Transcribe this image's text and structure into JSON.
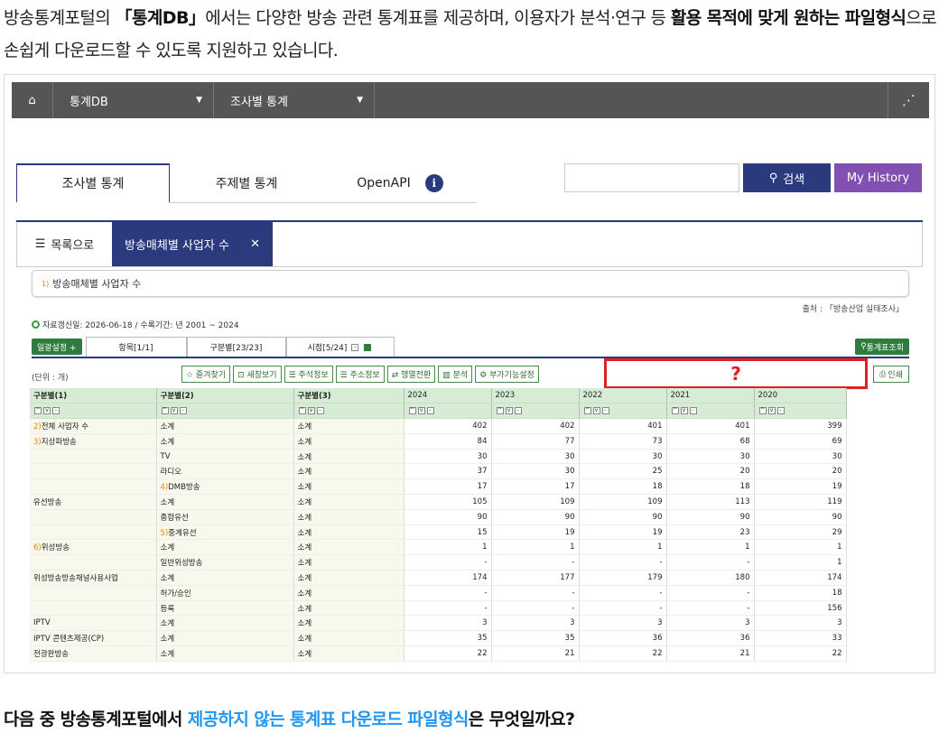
{
  "intro": {
    "p1": "방송통계포털의 ",
    "b1": "「통계DB」",
    "p2": "에서는 다양한 방송 관련 통계표를 제공하며, 이용자가 분석·연구 등 ",
    "b2": "활용 목적에 맞게 원하는 파일형식",
    "p3": "으로 손쉽게 다운로드할 수 있도록 지원하고 있습니다."
  },
  "topnav": {
    "home_icon": "home-icon",
    "menu1": "통계DB",
    "menu2": "조사별 통계",
    "share_icon": "share-icon"
  },
  "tabs": {
    "tab1": "조사별 통계",
    "tab2": "주제별 통계",
    "tab3": "OpenAPI",
    "info": "i"
  },
  "search": {
    "button": "검색",
    "history": "My History"
  },
  "subtabs": {
    "list": "목록으로",
    "active": "방송매체별 사업자 수",
    "close": "✕"
  },
  "title": {
    "num": "1)",
    "text": "방송매체별 사업자 수"
  },
  "source": "출처 :  「방송산업 실태조사」",
  "updated": "자료갱신일: 2026-06-18 / 수록기간: 년 2001 ~ 2024",
  "controls": {
    "bulk": "일괄설정 +",
    "items": "항목[1/1]",
    "cats": "구분별[23/23]",
    "time": "시점[5/24]",
    "view": "통계표조회"
  },
  "unit": "(단위 : 개)",
  "toolbar": [
    "☆ 즐겨찾기",
    "⊡ 새창보기",
    "☰ 주석정보",
    "☰ 주소정보",
    "⇄ 행열전환",
    "▥ 분석",
    "⚙ 부가기능설정"
  ],
  "question_mark": "?",
  "print": "인쇄",
  "table": {
    "headers": [
      "구분별(1)",
      "구분별(2)",
      "구분별(3)",
      "2024",
      "2023",
      "2022",
      "2021",
      "2020"
    ],
    "rows": [
      {
        "c1": "전체 사업자 수",
        "s1": "2)",
        "c2": "소계",
        "s2": "",
        "c3": "소계",
        "v": [
          "402",
          "402",
          "401",
          "401",
          "399"
        ]
      },
      {
        "c1": "지상파방송",
        "s1": "3)",
        "c2": "소계",
        "s2": "",
        "c3": "소계",
        "v": [
          "84",
          "77",
          "73",
          "68",
          "69"
        ]
      },
      {
        "c1": "",
        "s1": "",
        "c2": "TV",
        "s2": "",
        "c3": "소계",
        "v": [
          "30",
          "30",
          "30",
          "30",
          "30"
        ]
      },
      {
        "c1": "",
        "s1": "",
        "c2": "라디오",
        "s2": "",
        "c3": "소계",
        "v": [
          "37",
          "30",
          "25",
          "20",
          "20"
        ]
      },
      {
        "c1": "",
        "s1": "",
        "c2": "DMB방송",
        "s2": "4)",
        "c3": "소계",
        "v": [
          "17",
          "17",
          "18",
          "18",
          "19"
        ]
      },
      {
        "c1": "유선방송",
        "s1": "",
        "c2": "소계",
        "s2": "",
        "c3": "소계",
        "v": [
          "105",
          "109",
          "109",
          "113",
          "119"
        ]
      },
      {
        "c1": "",
        "s1": "",
        "c2": "종합유선",
        "s2": "",
        "c3": "소계",
        "v": [
          "90",
          "90",
          "90",
          "90",
          "90"
        ]
      },
      {
        "c1": "",
        "s1": "",
        "c2": "중계유선",
        "s2": "5)",
        "c3": "소계",
        "v": [
          "15",
          "19",
          "19",
          "23",
          "29"
        ]
      },
      {
        "c1": "위성방송",
        "s1": "6)",
        "c2": "소계",
        "s2": "",
        "c3": "소계",
        "v": [
          "1",
          "1",
          "1",
          "1",
          "1"
        ]
      },
      {
        "c1": "",
        "s1": "",
        "c2": "일반위성방송",
        "s2": "",
        "c3": "소계",
        "v": [
          "-",
          "-",
          "-",
          "-",
          "1"
        ]
      },
      {
        "c1": "위성방송방송채널사용사업",
        "s1": "",
        "c2": "소계",
        "s2": "",
        "c3": "소계",
        "v": [
          "174",
          "177",
          "179",
          "180",
          "174"
        ]
      },
      {
        "c1": "",
        "s1": "",
        "c2": "허가/승인",
        "s2": "",
        "c3": "소계",
        "v": [
          "-",
          "-",
          "-",
          "-",
          "18"
        ]
      },
      {
        "c1": "",
        "s1": "",
        "c2": "등록",
        "s2": "",
        "c3": "소계",
        "v": [
          "-",
          "-",
          "-",
          "-",
          "156"
        ]
      },
      {
        "c1": "IPTV",
        "s1": "",
        "c2": "소계",
        "s2": "",
        "c3": "소계",
        "v": [
          "3",
          "3",
          "3",
          "3",
          "3"
        ]
      },
      {
        "c1": "IPTV 콘텐츠제공(CP)",
        "s1": "",
        "c2": "소계",
        "s2": "",
        "c3": "소계",
        "v": [
          "35",
          "35",
          "36",
          "36",
          "33"
        ]
      },
      {
        "c1": "전광판방송",
        "s1": "",
        "c2": "소계",
        "s2": "",
        "c3": "소계",
        "v": [
          "22",
          "21",
          "22",
          "21",
          "22"
        ]
      }
    ]
  },
  "question": {
    "p1": "다음 중 방송통계포털에서 ",
    "hl": "제공하지 않는 통계표 다운로드 파일형식",
    "p2": "은 무엇일까요?"
  },
  "colors": {
    "nav": "#555555",
    "primary": "#2a3a7c",
    "history": "#8250b0",
    "green": "#2e7d3e",
    "question_box": "#e02020",
    "highlight": "#2196f3"
  }
}
